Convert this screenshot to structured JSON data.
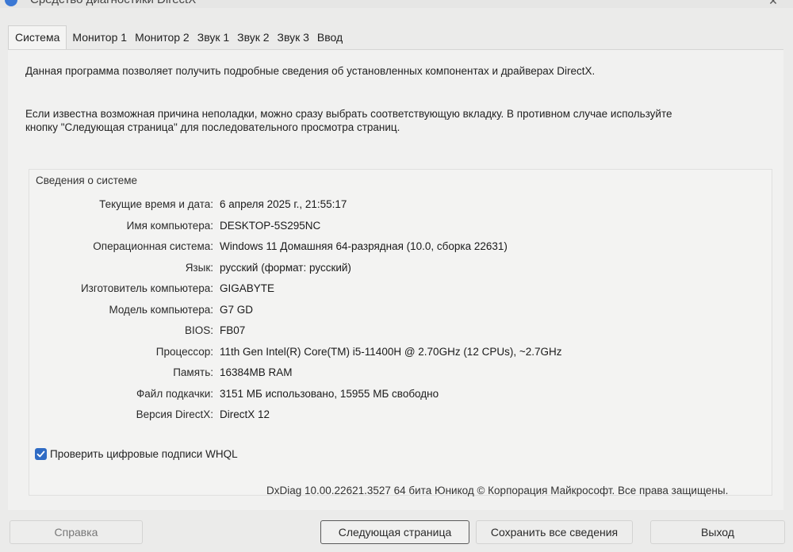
{
  "window": {
    "title": "Средство диагностики DirectX",
    "close_label": "✕"
  },
  "tabs": [
    {
      "label": "Система",
      "active": true
    },
    {
      "label": "Монитор 1"
    },
    {
      "label": "Монитор 2"
    },
    {
      "label": "Звук 1"
    },
    {
      "label": "Звук 2"
    },
    {
      "label": "Звук 3"
    },
    {
      "label": "Ввод"
    }
  ],
  "intro": {
    "line1": "Данная программа позволяет получить подробные сведения об установленных компонентах и драйверах DirectX.",
    "line2": "Если известна возможная причина неполадки, можно сразу выбрать соответствующую вкладку. В противном случае используйте",
    "line3": "кнопку \"Следующая страница\" для последовательного просмотра страниц."
  },
  "system_info": {
    "title": "Сведения о системе",
    "rows": [
      {
        "label": "Текущие время и дата:",
        "value": "6 апреля 2025 г., 21:55:17"
      },
      {
        "label": "Имя компьютера:",
        "value": "DESKTOP-5S295NC"
      },
      {
        "label": "Операционная система:",
        "value": "Windows 11 Домашняя 64-разрядная (10.0, сборка 22631)"
      },
      {
        "label": "Язык:",
        "value": "русский (формат: русский)"
      },
      {
        "label": "Изготовитель компьютера:",
        "value": "GIGABYTE"
      },
      {
        "label": "Модель компьютера:",
        "value": "G7 GD"
      },
      {
        "label": "BIOS:",
        "value": "FB07"
      },
      {
        "label": "Процессор:",
        "value": "11th Gen Intel(R) Core(TM) i5-11400H @ 2.70GHz (12 CPUs), ~2.7GHz"
      },
      {
        "label": "Память:",
        "value": "16384MB RAM"
      },
      {
        "label": "Файл подкачки:",
        "value": "3151 МБ использовано, 15955 МБ свободно"
      },
      {
        "label": "Версия DirectX:",
        "value": "DirectX 12"
      }
    ]
  },
  "whql": {
    "label": "Проверить цифровые подписи WHQL",
    "checked": true
  },
  "copyright": "DxDiag 10.00.22621.3527 64 бита Юникод © Корпорация Майкрософт. Все права защищены.",
  "buttons": {
    "help": "Справка",
    "next": "Следующая страница",
    "save": "Сохранить все сведения",
    "exit": "Выход"
  },
  "colors": {
    "accent": "#2f6bc4",
    "background": "#ebebea"
  }
}
